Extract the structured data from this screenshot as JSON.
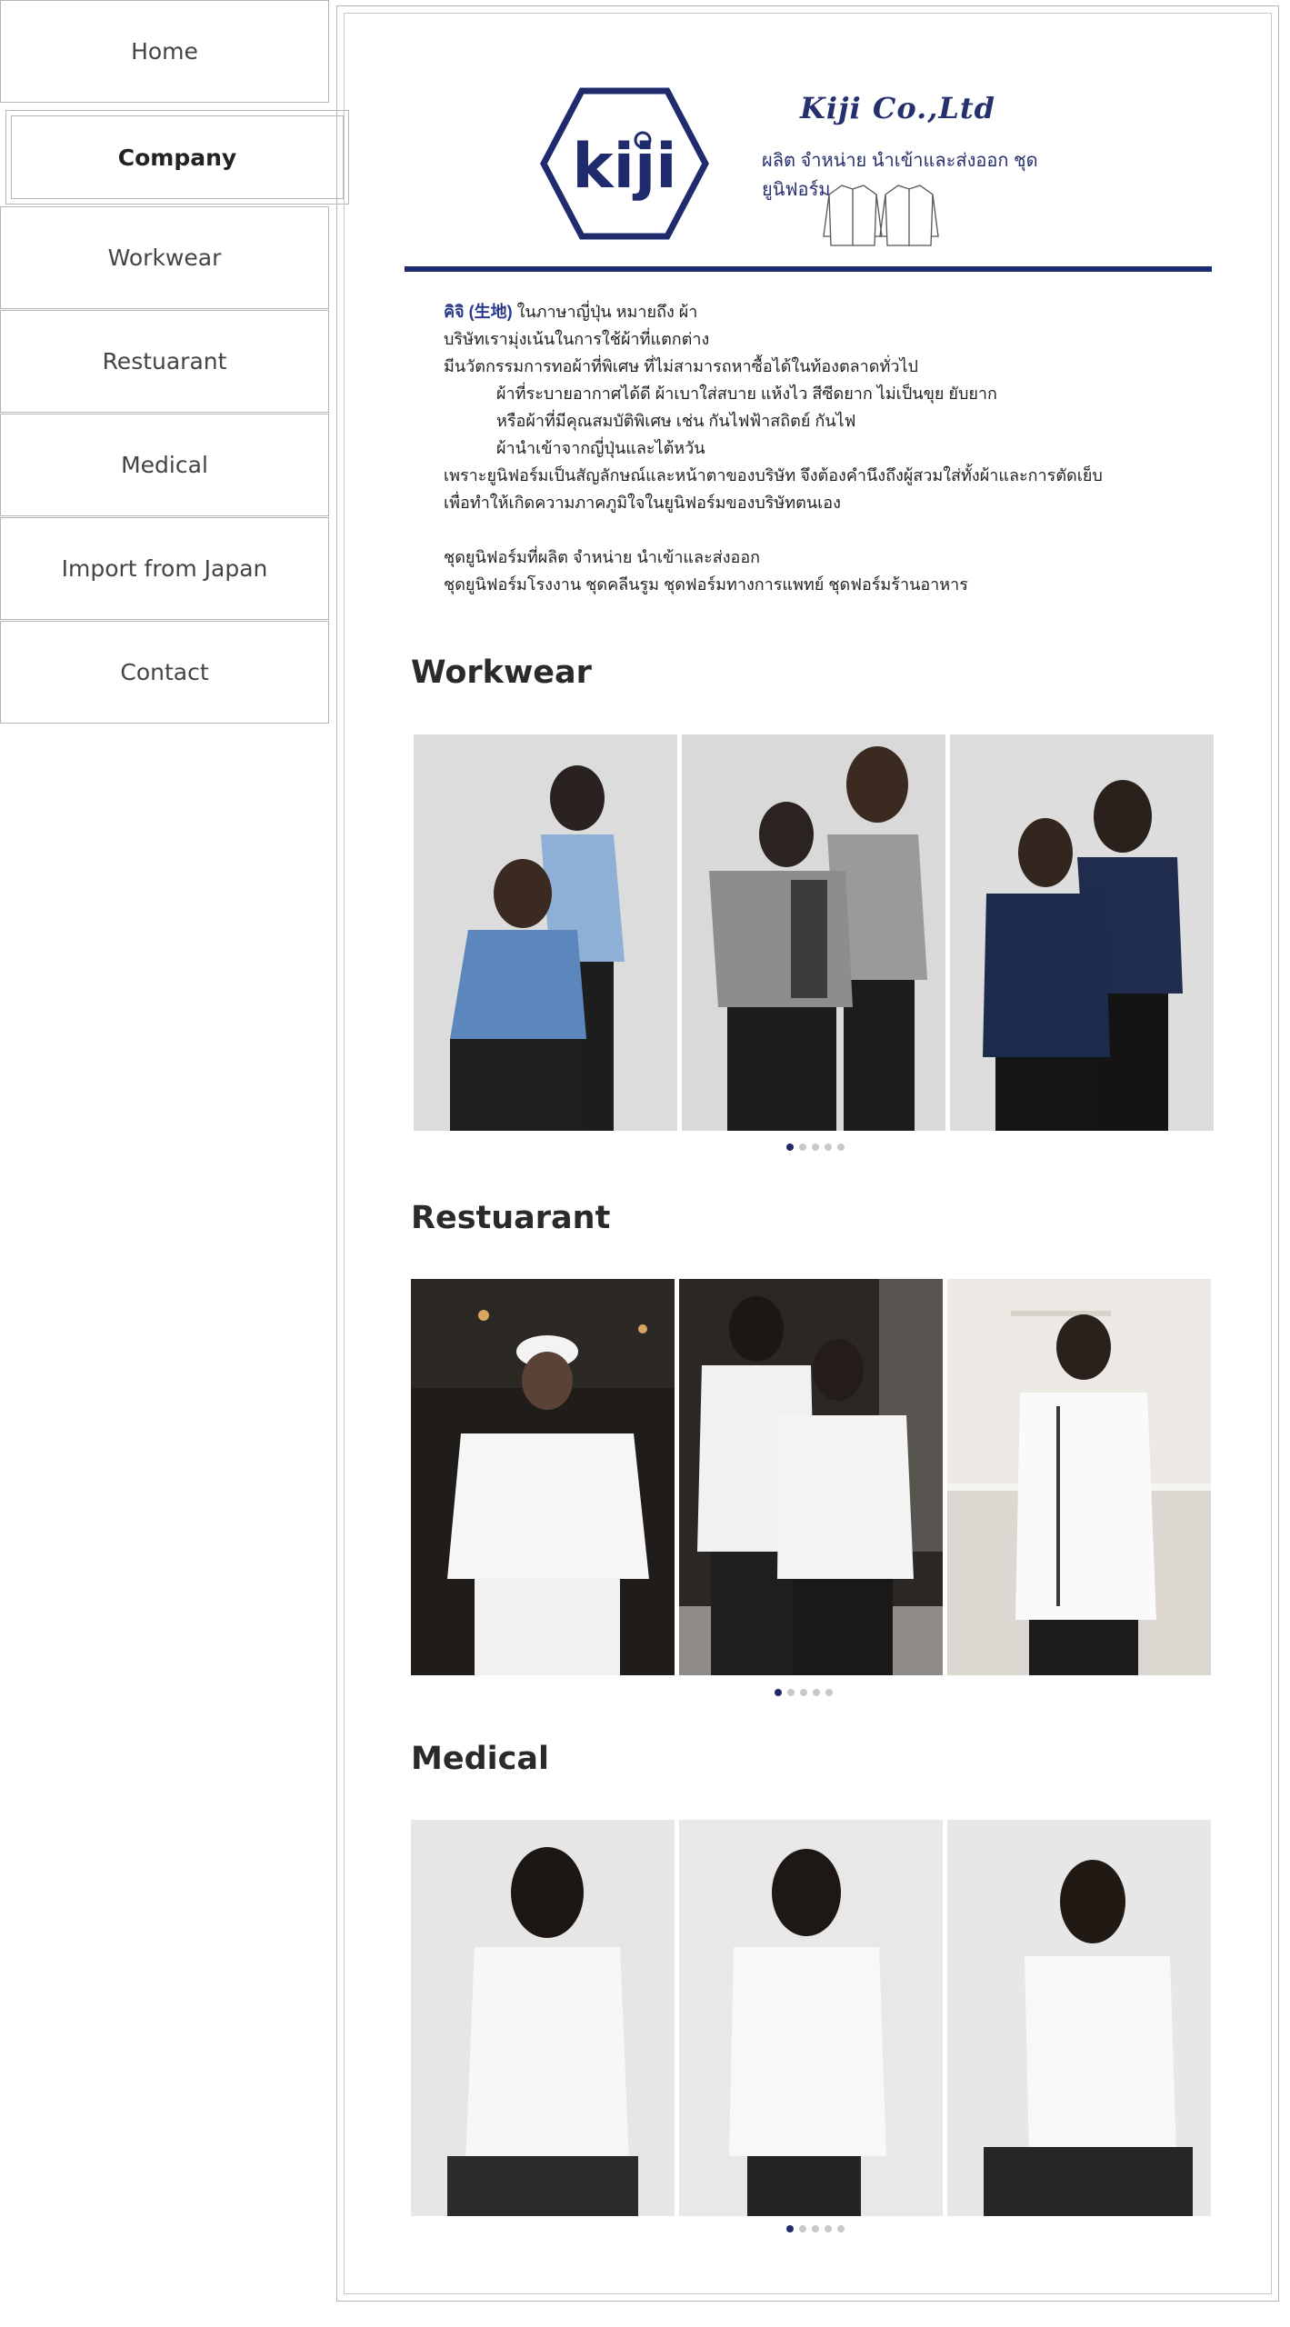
{
  "nav": {
    "items": [
      {
        "label": "Home"
      },
      {
        "label": "Company"
      },
      {
        "label": "Workwear"
      },
      {
        "label": "Restuarant"
      },
      {
        "label": "Medical"
      },
      {
        "label": "Import from Japan"
      },
      {
        "label": "Contact"
      }
    ],
    "active": "Company"
  },
  "header": {
    "logo_text": "kiji",
    "brand_name": "Kiji Co.,Ltd",
    "tagline": "ผลิต จำหน่าย นำเข้าและส่งออก ชุดยูนิฟอร์ม"
  },
  "intro": {
    "line1_highlight": "คิจิ (生地)",
    "line1_rest": " ในภาษาญี่ปุ่น หมายถึง ผ้า",
    "line2": "บริษัทเรามุ่งเน้นในการใช้ผ้าที่แตกต่าง",
    "line3": "มีนวัตกรรมการทอผ้าที่พิเศษ ที่ไม่สามารถหาซื้อได้ในท้องตลาดทั่วไป",
    "line4": "ผ้าที่ระบายอากาศได้ดี ผ้าเบาใส่สบาย แห้งไว สีซีดยาก ไม่เป็นขุย ยับยาก",
    "line5": "หรือผ้าที่มีคุณสมบัติพิเศษ เช่น กันไฟฟ้าสถิตย์ กันไฟ",
    "line6": "ผ้านำเข้าจากญี่ปุ่นและไต้หวัน",
    "line7": "เพราะยูนิฟอร์มเป็นสัญลักษณ์และหน้าตาของบริษัท จึงต้องคำนึงถึงผู้สวมใส่ทั้งผ้าและการตัดเย็บ",
    "line8": "เพื่อทำให้เกิดความภาคภูมิใจในยูนิฟอร์มของบริษัทตนเอง",
    "line9": "ชุดยูนิฟอร์มที่ผลิต จำหน่าย นำเข้าและส่งออก",
    "line10": "ชุดยูนิฟอร์มโรงงาน ชุดคลีนรูม ชุดฟอร์มทางการแพทย์ ชุดฟอร์มร้านอาหาร"
  },
  "sections": {
    "workwear": {
      "title": "Workwear",
      "active_dot": 1,
      "dot_count": 5
    },
    "restaurant": {
      "title": "Restuarant",
      "active_dot": 1,
      "dot_count": 5
    },
    "medical": {
      "title": "Medical",
      "active_dot": 1,
      "dot_count": 5
    }
  },
  "colors": {
    "brand_navy": "#1f2b6c",
    "border_gray": "#b5b5b5",
    "dot_inactive": "#c9c9c9"
  }
}
